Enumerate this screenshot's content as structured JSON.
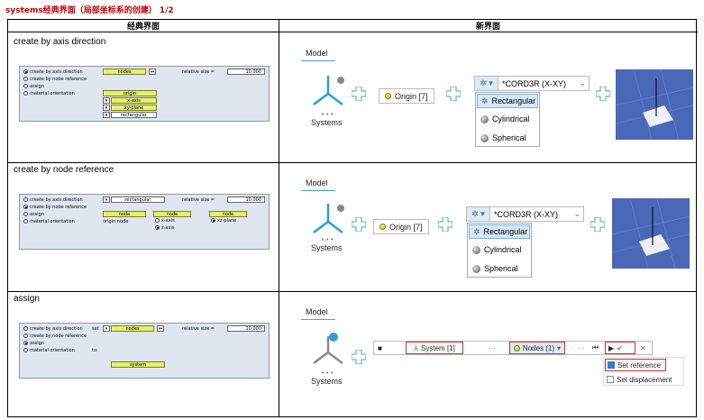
{
  "doc_title": "systems经典界面（局部坐标系的创建） 1/2",
  "headers": {
    "classic": "经典界面",
    "new": "新界面"
  },
  "rows": [
    {
      "title": "create by axis direction"
    },
    {
      "title": "create by node reference"
    },
    {
      "title": "assign"
    }
  ],
  "classic1": {
    "radios": [
      "create by axis direction",
      "create by node reference",
      "assign",
      "material orientation"
    ],
    "nodes": "nodes",
    "relative_size_label": "relative size =",
    "relative_size_value": "10.000",
    "origin": "origin",
    "xaxis": "x-axis",
    "xyplane": "xy-plane",
    "rectangular": "rectangular"
  },
  "classic2": {
    "radios": [
      "create by axis direction",
      "create by node reference",
      "assign",
      "material orientation"
    ],
    "rectangular": "rectangular",
    "relative_size_label": "relative size =",
    "relative_size_value": "10.000",
    "node": "node",
    "origin_node": "origin node",
    "xaxis": "x-axis",
    "zaxis": "z-axis",
    "xzplane": "xz-plane"
  },
  "classic3": {
    "radios": [
      "create by axis direction",
      "create by node reference",
      "assign",
      "material orientation"
    ],
    "set": "set",
    "nodes": "nodes",
    "relative_size_label": "relative size =",
    "relative_size_value": "10.000",
    "to": "to:",
    "system": "system"
  },
  "new": {
    "model": "Model",
    "systems": "Systems",
    "origin": "Origin [7]",
    "cord": "*CORD3R (X-XY)",
    "menu": [
      "Rectangular",
      "Cylindrical",
      "Spherical"
    ],
    "system_btn": "System [1]",
    "nodes_btn": "Nodes (1)",
    "set_reference": "Set reference",
    "set_displacement": "Set displacement"
  },
  "colors": {
    "title_red": "#c00000",
    "accent_blue": "#4aa3c8",
    "highlight_red": "#d32f2f",
    "classic_yellow": "#e6f06a"
  }
}
